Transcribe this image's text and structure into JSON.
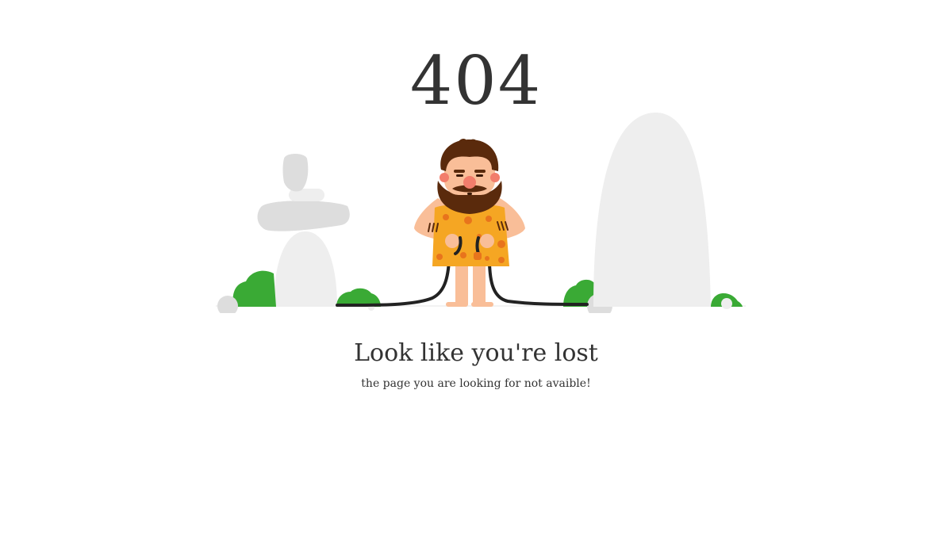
{
  "error": {
    "code": "404"
  },
  "message": {
    "headline": "Look like you're lost",
    "subline": "the page you are looking for not avaible!"
  },
  "illustration": {
    "name": "caveman-with-unplugged-cable",
    "colors": {
      "rock": "#eeeeee",
      "rock_dark": "#dddddd",
      "bush": "#3aaa35",
      "skin": "#f9be98",
      "hair": "#5a2a0c",
      "tunic": "#f5a623",
      "tunic_spots": "#e8741c",
      "cable": "#222222",
      "nose": "#f27d6b"
    }
  }
}
